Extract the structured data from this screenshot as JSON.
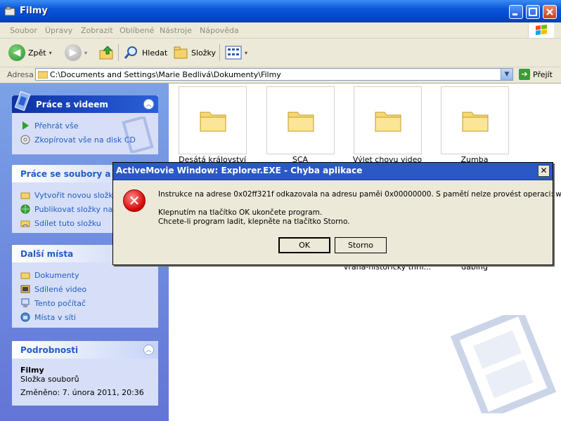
{
  "window": {
    "title": "Filmy"
  },
  "menu": [
    "Soubor",
    "Úpravy",
    "Zobrazit",
    "Oblíbené",
    "Nástroje",
    "Nápověda"
  ],
  "toolbar": {
    "back": "Zpět",
    "search": "Hledat",
    "folders": "Složky"
  },
  "address": {
    "label": "Adresa",
    "path": "C:\\Documents and Settings\\Marie Bedlivá\\Dokumenty\\Filmy",
    "go": "Přejít"
  },
  "tasks": {
    "video": {
      "title": "Práce s videem",
      "items": [
        "Přehrát vše",
        "Zkopírovat vše na disk CD"
      ]
    },
    "files": {
      "title": "Práce se soubory a slo",
      "items": [
        "Vytvořit novou složku",
        "Publikovat složky na w",
        "Sdílet tuto složku"
      ]
    },
    "places": {
      "title": "Další místa",
      "items": [
        "Dokumenty",
        "Sdílené video",
        "Tento počítač",
        "Místa v síti"
      ]
    },
    "details": {
      "title": "Podrobnosti",
      "name": "Filmy",
      "type": "Složka souborů",
      "modified": "Změněno: 7. února 2011, 20:36"
    }
  },
  "folders": [
    {
      "name": "Desátá království",
      "extra": ""
    },
    {
      "name": "SCA",
      "extra": ""
    },
    {
      "name": "Výlet chovu video",
      "extra": "vraha-historicky thril..."
    },
    {
      "name": "Zumba",
      "extra": "dabing"
    }
  ],
  "dialog": {
    "title": "ActiveMovie Window: Explorer.EXE - Chyba aplikace",
    "line1": "Instrukce na adrese 0x02ff321f odkazovala na adresu paměi 0x00000000. S pamětí nelze provést operaci: written.",
    "line2": "Klepnutím na tlačítko OK ukončete program.",
    "line3": "Chcete-li program ladit, klepněte na tlačítko Storno.",
    "ok": "OK",
    "cancel": "Storno"
  }
}
